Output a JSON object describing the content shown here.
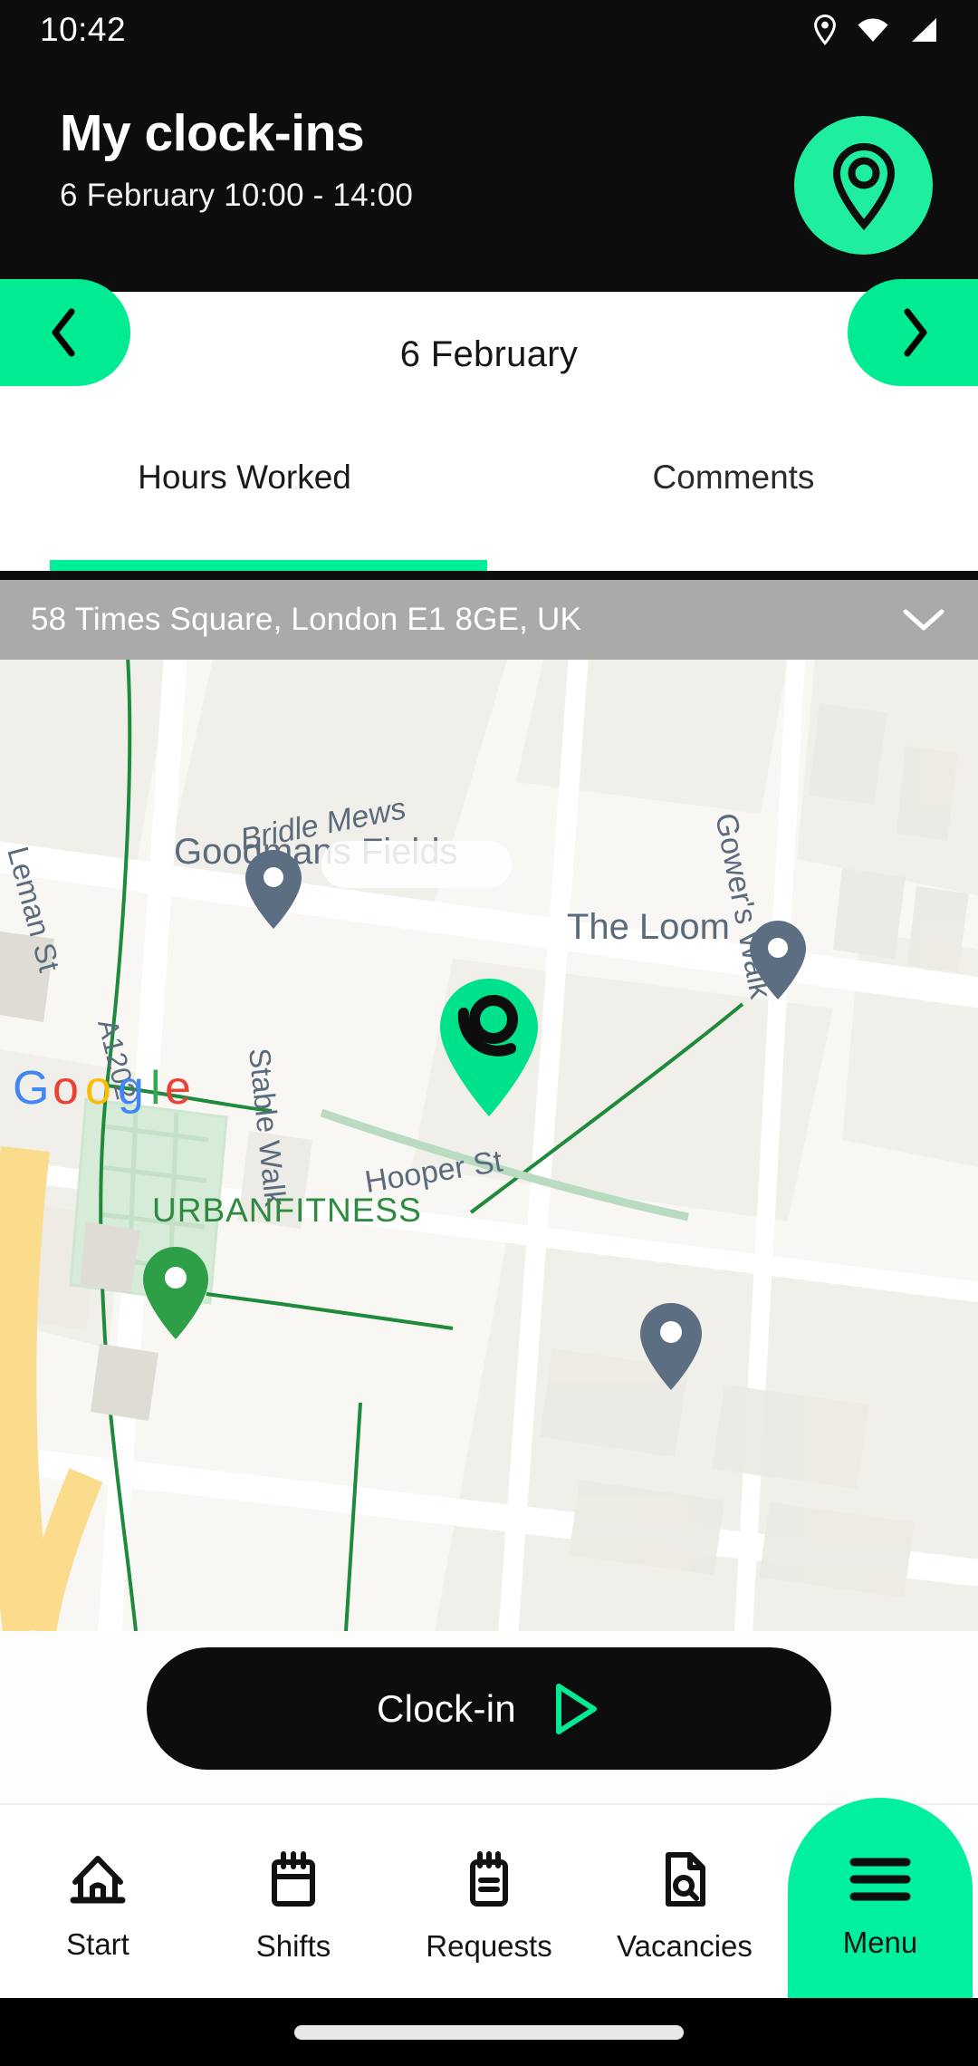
{
  "status_bar": {
    "time": "10:42",
    "icons": [
      "location-pin-icon",
      "wifi-icon",
      "signal-icon"
    ]
  },
  "header": {
    "title": "My clock-ins",
    "subtitle": "6 February 10:00 - 14:00",
    "fab_icon": "location-pin-icon"
  },
  "date_nav": {
    "prev_icon": "chevron-left-icon",
    "next_icon": "chevron-right-icon",
    "current_date": "6 February"
  },
  "tabs": [
    {
      "label": "Hours Worked",
      "active": true
    },
    {
      "label": "Comments",
      "active": false
    }
  ],
  "address": {
    "value": "58 Times Square, London E1 8GE, UK",
    "dropdown_icon": "chevron-down-icon"
  },
  "map": {
    "attribution": "Google",
    "labels": [
      "Goodmans Fields",
      "Bridle Mews",
      "Gower's Walk",
      "The Loom",
      "Stable Walk",
      "URBANFITNESS",
      "Hooper St",
      "Leman St",
      "A1202"
    ],
    "markers": [
      {
        "name": "goodmans-fields-marker",
        "color": "#5b6e82"
      },
      {
        "name": "the-loom-marker",
        "color": "#5b6e82"
      },
      {
        "name": "current-location-marker",
        "color": "#00e590"
      },
      {
        "name": "urbanfitness-marker",
        "color": "#2e9e47"
      },
      {
        "name": "lower-right-marker",
        "color": "#5b6e82"
      }
    ]
  },
  "clock_in": {
    "label": "Clock-in",
    "icon": "play-icon"
  },
  "bottom_nav": [
    {
      "label": "Start",
      "icon": "home-icon",
      "active": false
    },
    {
      "label": "Shifts",
      "icon": "calendar-icon",
      "active": false
    },
    {
      "label": "Requests",
      "icon": "notepad-icon",
      "active": false
    },
    {
      "label": "Vacancies",
      "icon": "document-search-icon",
      "active": false
    },
    {
      "label": "Menu",
      "icon": "hamburger-icon",
      "active": true
    }
  ],
  "colors": {
    "accent_green": "#00f0a0",
    "fab_green": "#1fee9e",
    "header_black": "#0d0d0d",
    "address_grey": "#aaaaaa"
  }
}
